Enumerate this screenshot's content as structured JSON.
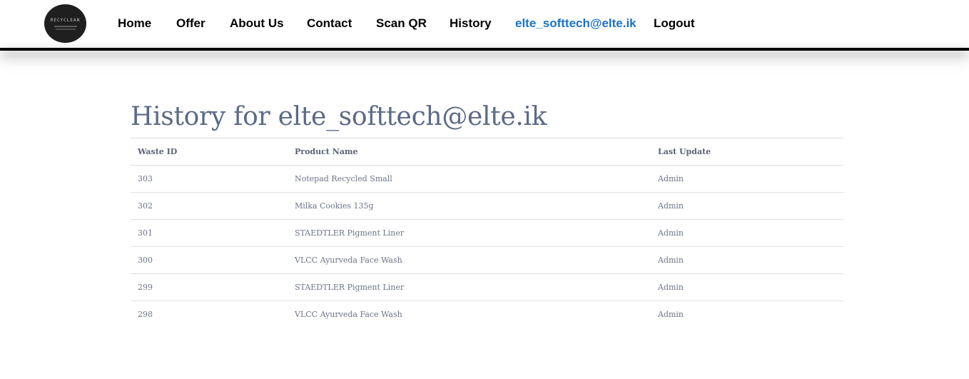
{
  "nav": {
    "logo_text": "RECYCLEAN",
    "items": [
      {
        "label": "Home"
      },
      {
        "label": "Offer"
      },
      {
        "label": "About Us"
      },
      {
        "label": "Contact"
      },
      {
        "label": "Scan QR"
      },
      {
        "label": "History"
      },
      {
        "label": "elte_softtech@elte.ik"
      },
      {
        "label": "Logout"
      }
    ],
    "accent_color": "#1a73c8"
  },
  "main": {
    "title": "History for elte_softtech@elte.ik",
    "table": {
      "columns": [
        "Waste ID",
        "Product Name",
        "Last Update"
      ],
      "rows": [
        [
          "303",
          "Notepad Recycled Small",
          "Admin"
        ],
        [
          "302",
          "Milka Cookies 135g",
          "Admin"
        ],
        [
          "301",
          "STAEDTLER Pigment Liner",
          "Admin"
        ],
        [
          "300",
          "VLCC Ayurveda Face Wash",
          "Admin"
        ],
        [
          "299",
          "STAEDTLER Pigment Liner",
          "Admin"
        ],
        [
          "298",
          "VLCC Ayurveda Face Wash",
          "Admin"
        ]
      ]
    }
  }
}
